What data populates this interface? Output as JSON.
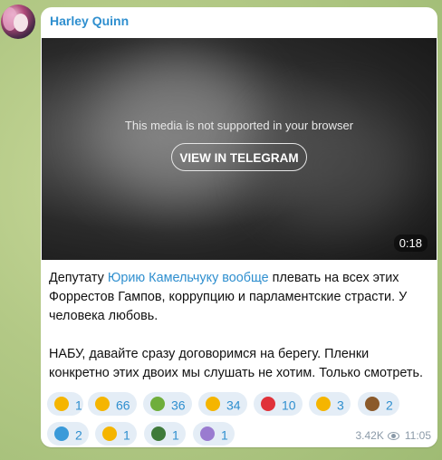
{
  "channel": {
    "sender": "Harley Quinn"
  },
  "media": {
    "unsupported_text": "This media is not supported in your browser",
    "button_label": "VIEW IN TELEGRAM",
    "duration": "0:18"
  },
  "message": {
    "line1_pre": "Депутату ",
    "link1": "Юрию Камельчуку вообще",
    "line1_post": " плевать на всех этих Форрестов Гампов, коррупцию и парламентские страсти. У человека любовь.",
    "paragraph2": "НАБУ, давайте сразу договоримся на берегу. Пленки конкретно этих двоих мы слушать не хотим. Только смотреть."
  },
  "reactions": [
    {
      "icon": "star-icon",
      "emoji": "⭐",
      "count": "1",
      "color": "#f5b500"
    },
    {
      "icon": "grin-icon",
      "emoji": "😁",
      "count": "66",
      "color": "#f5b500"
    },
    {
      "icon": "nauseated-icon",
      "emoji": "🤮",
      "count": "36",
      "color": "#6fae3b"
    },
    {
      "icon": "crazy-face-icon",
      "emoji": "🤪",
      "count": "34",
      "color": "#f5b500"
    },
    {
      "icon": "strawberry-icon",
      "emoji": "🍓",
      "count": "10",
      "color": "#e0323a"
    },
    {
      "icon": "thumbs-up-icon",
      "emoji": "👍",
      "count": "3",
      "color": "#f5b500"
    },
    {
      "icon": "poop-icon",
      "emoji": "💩",
      "count": "2",
      "color": "#8b5a2b"
    },
    {
      "icon": "whale-icon",
      "emoji": "🐳",
      "count": "2",
      "color": "#3a9ad9"
    },
    {
      "icon": "smiling-hearts-icon",
      "emoji": "🥰",
      "count": "1",
      "color": "#f5b500"
    },
    {
      "icon": "champagne-icon",
      "emoji": "🍾",
      "count": "1",
      "color": "#3f7a3a"
    },
    {
      "icon": "syringe-icon",
      "emoji": "💉",
      "count": "1",
      "color": "#9a7bd0"
    }
  ],
  "meta": {
    "views": "3.42K",
    "time": "11:05"
  }
}
